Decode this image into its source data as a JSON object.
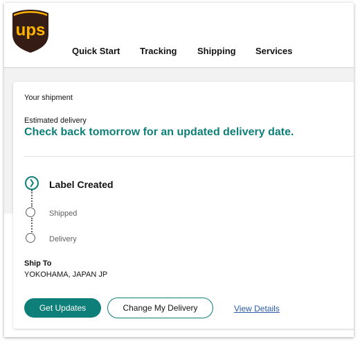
{
  "header": {
    "logo_text": "ups",
    "nav": [
      {
        "label": "Quick Start"
      },
      {
        "label": "Tracking"
      },
      {
        "label": "Shipping"
      },
      {
        "label": "Services"
      }
    ]
  },
  "shipment": {
    "heading": "Your shipment",
    "estimated_label": "Estimated delivery",
    "estimated_value": "Check back tomorrow for an updated delivery date.",
    "steps": [
      {
        "label": "Label Created",
        "state": "current"
      },
      {
        "label": "Shipped",
        "state": "pending"
      },
      {
        "label": "Delivery",
        "state": "pending"
      }
    ],
    "ship_to_label": "Ship To",
    "ship_to_value": "YOKOHAMA, JAPAN JP"
  },
  "actions": {
    "get_updates": "Get Updates",
    "change_delivery": "Change My Delivery",
    "view_details": "View Details"
  },
  "colors": {
    "brand_brown": "#351c15",
    "brand_gold": "#ffb500",
    "teal": "#0f7f79",
    "link_blue": "#2b5aa8"
  },
  "icons": {
    "current_step": "chevron-right-icon",
    "pending_step": "circle-icon"
  }
}
